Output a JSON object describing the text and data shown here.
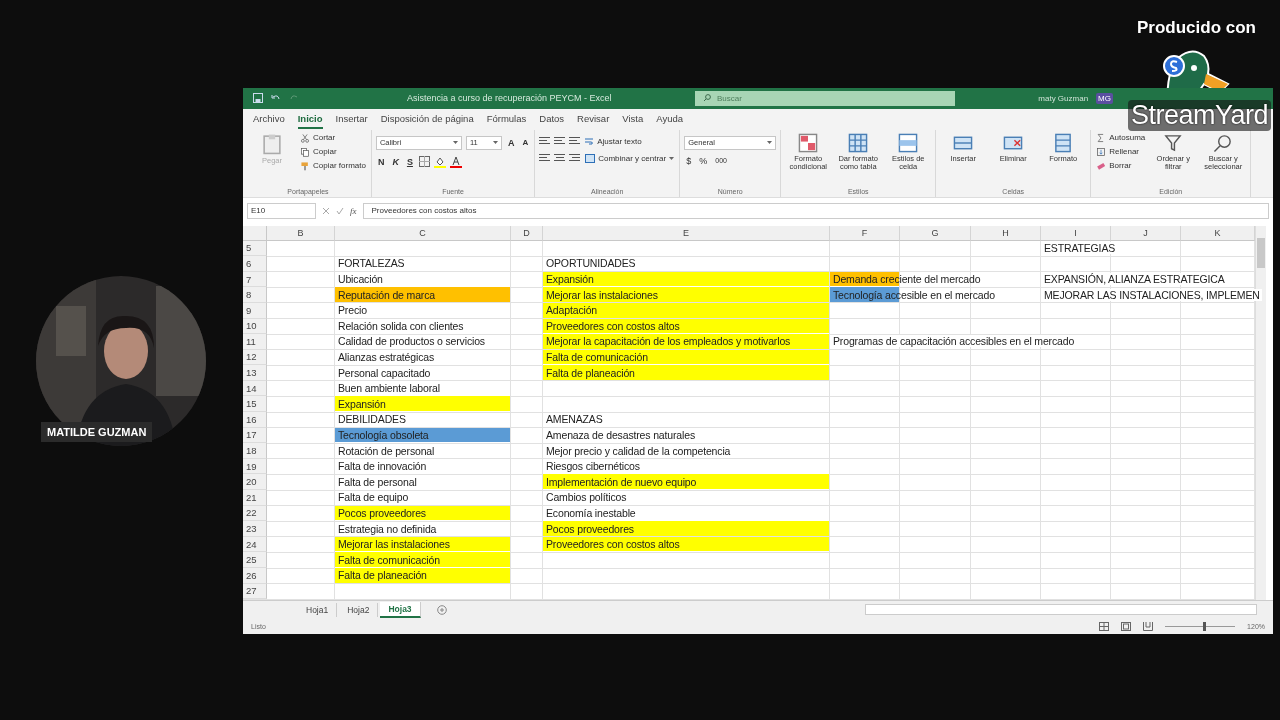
{
  "stream": {
    "produced_by": "Producido con",
    "logo_text": "StreamYard"
  },
  "presenter": {
    "name": "MATILDE GUZMAN"
  },
  "window": {
    "title": "Asistencia a curso de recuperación PEYCM - Excel",
    "search_placeholder": "Buscar",
    "user": "maty Guzman",
    "avatar": "MG"
  },
  "menu_tabs": [
    {
      "label": "Archivo",
      "selected": false
    },
    {
      "label": "Inicio",
      "selected": true
    },
    {
      "label": "Insertar",
      "selected": false
    },
    {
      "label": "Disposición de página",
      "selected": false
    },
    {
      "label": "Fórmulas",
      "selected": false
    },
    {
      "label": "Datos",
      "selected": false
    },
    {
      "label": "Revisar",
      "selected": false
    },
    {
      "label": "Vista",
      "selected": false
    },
    {
      "label": "Ayuda",
      "selected": false
    }
  ],
  "ribbon": {
    "groups": [
      {
        "kind": "clipboard",
        "label": "Portapapeles",
        "paste": {
          "label": "Pegar",
          "disabled": true
        },
        "items": [
          "Cortar",
          "Copiar",
          "Copiar formato"
        ]
      },
      {
        "kind": "font",
        "label": "Fuente",
        "font": "Calibri",
        "size": "11",
        "grow": "A",
        "shrink": "A",
        "styles": [
          "N",
          "K",
          "S"
        ]
      },
      {
        "kind": "alignment",
        "label": "Alineación",
        "wrap": "Ajustar texto",
        "merge": "Combinar y centrar"
      },
      {
        "kind": "number",
        "label": "Número",
        "format": "General",
        "symbols": [
          "$",
          "%",
          "000"
        ]
      },
      {
        "kind": "styles",
        "label": "Estilos",
        "buttons": [
          "Formato condicional",
          "Dar formato como tabla",
          "Estilos de celda"
        ]
      },
      {
        "kind": "cells",
        "label": "Celdas",
        "buttons": [
          "Insertar",
          "Eliminar",
          "Formato"
        ]
      },
      {
        "kind": "editing",
        "label": "Edición",
        "items": [
          "Autosuma",
          "Rellenar",
          "Borrar"
        ],
        "buttons": [
          "Ordenar y filtrar",
          "Buscar y seleccionar"
        ]
      }
    ]
  },
  "formula_bar": {
    "cell": "E10",
    "fx": "fx",
    "value": "Proveedores con costos altos"
  },
  "sheet": {
    "columns": [
      "B",
      "C",
      "D",
      "E",
      "F",
      "G",
      "H",
      "I",
      "J",
      "K"
    ],
    "rows": [
      {
        "number": "5",
        "cells": [
          "",
          "",
          "",
          "",
          "",
          "",
          "",
          {
            "text": "ESTRATEGIAS"
          }
        ]
      },
      {
        "number": "6",
        "cells": [
          "",
          {
            "text": "FORTALEZAS"
          },
          "",
          {
            "text": "OPORTUNIDADES"
          }
        ]
      },
      {
        "number": "7",
        "cells": [
          "",
          {
            "text": "Ubicación"
          },
          "",
          {
            "text": "Expansión",
            "color": "#ffff00"
          },
          {
            "text": "Demanda creciente del mercado",
            "color": "#ffc000"
          },
          "",
          "",
          {
            "text": "EXPANSIÓN, ALIANZA ESTRATEGICA"
          }
        ]
      },
      {
        "number": "8",
        "cells": [
          "",
          {
            "text": "Reputación de marca",
            "color": "#ffc000"
          },
          "",
          {
            "text": "Mejorar las instalaciones",
            "color": "#ffff00"
          },
          {
            "text": "Tecnología accesible en el mercado",
            "color": "#5b9bd5"
          },
          "",
          "",
          {
            "text": "MEJORAR LAS INSTALACIONES, IMPLEMEN"
          }
        ]
      },
      {
        "number": "9",
        "cells": [
          "",
          {
            "text": "Precio"
          },
          "",
          {
            "text": "Adaptación",
            "color": "#ffff00"
          }
        ]
      },
      {
        "number": "10",
        "cells": [
          "",
          {
            "text": "Relación solida con clientes"
          },
          "",
          {
            "text": "Proveedores con costos altos",
            "color": "#ffff00"
          }
        ]
      },
      {
        "number": "11",
        "cells": [
          "",
          {
            "text": "Calidad de productos o servicios"
          },
          "",
          {
            "text": "Mejorar la capacitación de los empleados y motivarlos",
            "color": "#ffff00"
          },
          {
            "text": "Programas de capacitación accesibles en el mercado"
          }
        ]
      },
      {
        "number": "12",
        "cells": [
          "",
          {
            "text": "Alianzas estratégicas"
          },
          "",
          {
            "text": "Falta de comunicación",
            "color": "#ffff00"
          }
        ]
      },
      {
        "number": "13",
        "cells": [
          "",
          {
            "text": "Personal capacitado"
          },
          "",
          {
            "text": "Falta de planeación",
            "color": "#ffff00"
          }
        ]
      },
      {
        "number": "14",
        "cells": [
          "",
          {
            "text": "Buen ambiente laboral"
          }
        ]
      },
      {
        "number": "15",
        "cells": [
          "",
          {
            "text": "Expansión",
            "color": "#ffff00"
          }
        ]
      },
      {
        "number": "16",
        "cells": [
          "",
          {
            "text": "DEBILIDADES"
          },
          "",
          {
            "text": "AMENAZAS"
          }
        ]
      },
      {
        "number": "17",
        "cells": [
          "",
          {
            "text": "Tecnología obsoleta",
            "color": "#5b9bd5"
          },
          "",
          {
            "text": "Amenaza de desastres naturales"
          }
        ]
      },
      {
        "number": "18",
        "cells": [
          "",
          {
            "text": "Rotación de personal"
          },
          "",
          {
            "text": "Mejor precio y calidad de la competencia"
          }
        ]
      },
      {
        "number": "19",
        "cells": [
          "",
          {
            "text": "Falta de innovación"
          },
          "",
          {
            "text": "Riesgos cibernéticos"
          }
        ]
      },
      {
        "number": "20",
        "cells": [
          "",
          {
            "text": "Falta de personal"
          },
          "",
          {
            "text": "Implementación de nuevo equipo",
            "color": "#ffff00"
          }
        ]
      },
      {
        "number": "21",
        "cells": [
          "",
          {
            "text": "Falta de equipo"
          },
          "",
          {
            "text": "Cambios políticos"
          }
        ]
      },
      {
        "number": "22",
        "cells": [
          "",
          {
            "text": "Pocos proveedores",
            "color": "#ffff00"
          },
          "",
          {
            "text": "Economía inestable"
          }
        ]
      },
      {
        "number": "23",
        "cells": [
          "",
          {
            "text": "Estrategia no definida"
          },
          "",
          {
            "text": "Pocos proveedores",
            "color": "#ffff00"
          }
        ]
      },
      {
        "number": "24",
        "cells": [
          "",
          {
            "text": "Mejorar las instalaciones",
            "color": "#ffff00"
          },
          "",
          {
            "text": "Proveedores con costos altos",
            "color": "#ffff00"
          }
        ]
      },
      {
        "number": "25",
        "cells": [
          "",
          {
            "text": "Falta de comunicación",
            "color": "#ffff00"
          }
        ]
      },
      {
        "number": "26",
        "cells": [
          "",
          {
            "text": "Falta de planeación",
            "color": "#ffff00"
          }
        ]
      },
      {
        "number": "27"
      }
    ]
  },
  "sheet_tabs": [
    {
      "label": "Hoja1",
      "selected": false
    },
    {
      "label": "Hoja2",
      "selected": false
    },
    {
      "label": "Hoja3",
      "selected": true
    }
  ],
  "status_bar": {
    "text": "Listo",
    "zoom": "120%",
    "zoom_slider": {
      "level": 0.56
    }
  }
}
